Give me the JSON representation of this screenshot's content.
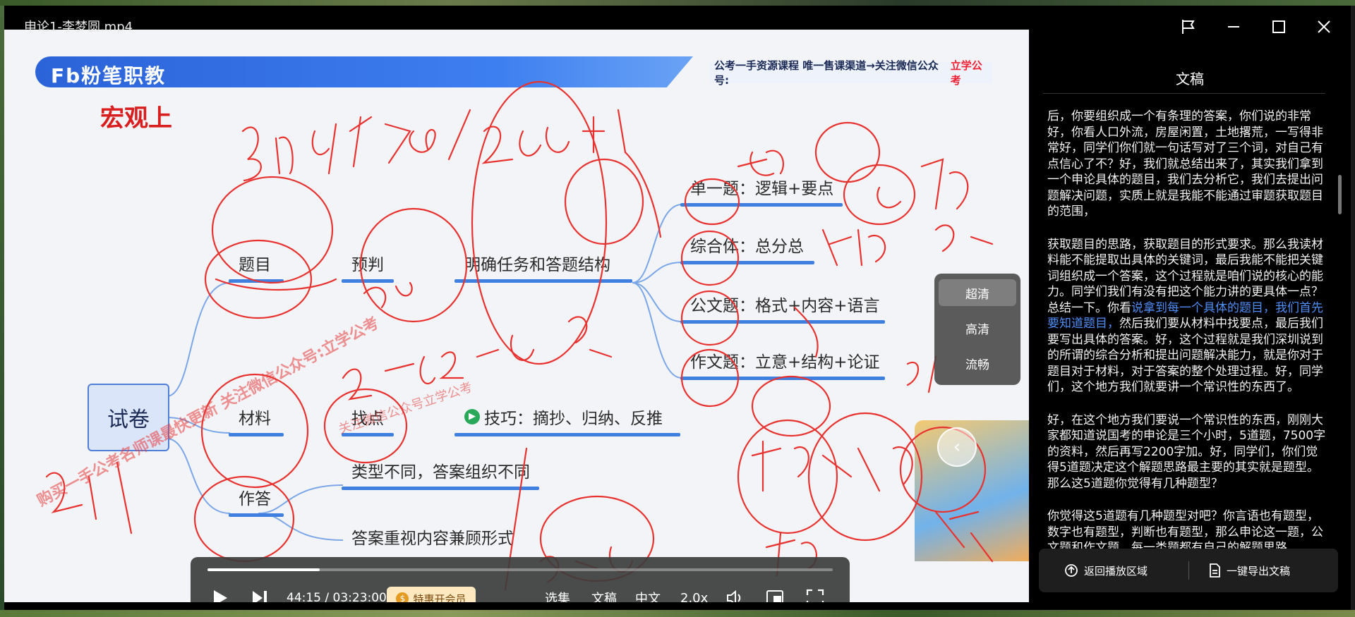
{
  "window": {
    "title": "申论1-李梦圆.mp4"
  },
  "slide": {
    "logo": "Fb粉笔职教",
    "banner_text": "公考一手资源课程 唯一售课渠道→关注微信公众号:",
    "banner_highlight": "立学公考",
    "heading": "宏观上",
    "root": "试卷",
    "level1": [
      "题目",
      "材料",
      "作答"
    ],
    "predict": "预判",
    "predict_detail": "明确任务和答题结构",
    "find": "找点",
    "technique": "技巧：摘抄、归纳、反推",
    "answer_a": "类型不同，答案组织不同",
    "answer_b": "答案重视内容兼顾形式",
    "types": [
      "单一题：逻辑+要点",
      "综合体：总分总",
      "公文题：格式+内容+语言",
      "作文题：立意+结构+论证"
    ],
    "watermark": "购买一手公考名师课最快更新 关注微信公众号:立学公考",
    "watermark2": "关注微信公众号立学公考"
  },
  "quality_menu": {
    "items": [
      "超清",
      "高清",
      "流畅"
    ],
    "active": "超清"
  },
  "player": {
    "time": "44:15 / 03:23:00",
    "progress": 0.18,
    "vip_label": "特惠开会员",
    "episodes": "选集",
    "transcript": "文稿",
    "subtitle": "中文",
    "speed": "2.0x"
  },
  "panel": {
    "title": "文稿",
    "paragraphs": [
      {
        "text": "后，你要组织成一个有条理的答案，你们说的非常好，你看人口外流，房屋闲置，土地撂荒，一写得非常好，同学们你们就一句话写对了三个词，对自己有点信心了不？好，我们就总结出来了，其实我们拿到一个申论具体的题目，我们去分析它，我们去提出问题解决问题，实质上就是我能不能通过审题获取题目的范围，"
      },
      {
        "before": "获取题目的思路，获取题目的形式要求。那么我读材料能不能提取出具体的关键词，最后我能不能把关键词组织成一个答案，这个过程就是咱们说的核心的能力。同学们我们有没有把这个能力讲的更具体一点？总结一下。你看",
        "link": "说拿到每一个具体的题目，我们首先要知道题目，",
        "after": "然后我们要从材料中找要点，最后我们要写出具体的答案。好，这个过程就是我们深圳说到的所谓的综合分析和提出问题解决能力，就是你对于题目对于材料，对于答案的整个处理过程。好，同学们，这个地方我们就要讲一个常识性的东西了。"
      },
      {
        "text": "好，在这个地方我们要说一个常识性的东西，刚刚大家都知道说国考的申论是三个小时，5道题，7500字的资料，然后再写2200字加。好，同学们，你们觉得5道题决定这个解题思路最主要的其实就是题型。那么这5道题你觉得有几种题型？"
      },
      {
        "text": "你觉得这5道题有几种题型对吧？你言语也有题型，数字也有题型，判断也有题型，那么申论这一题，公文题和作文题，每一类题都有自己的解题思路"
      }
    ],
    "back_label": "返回播放区域",
    "export_label": "一键导出文稿"
  }
}
